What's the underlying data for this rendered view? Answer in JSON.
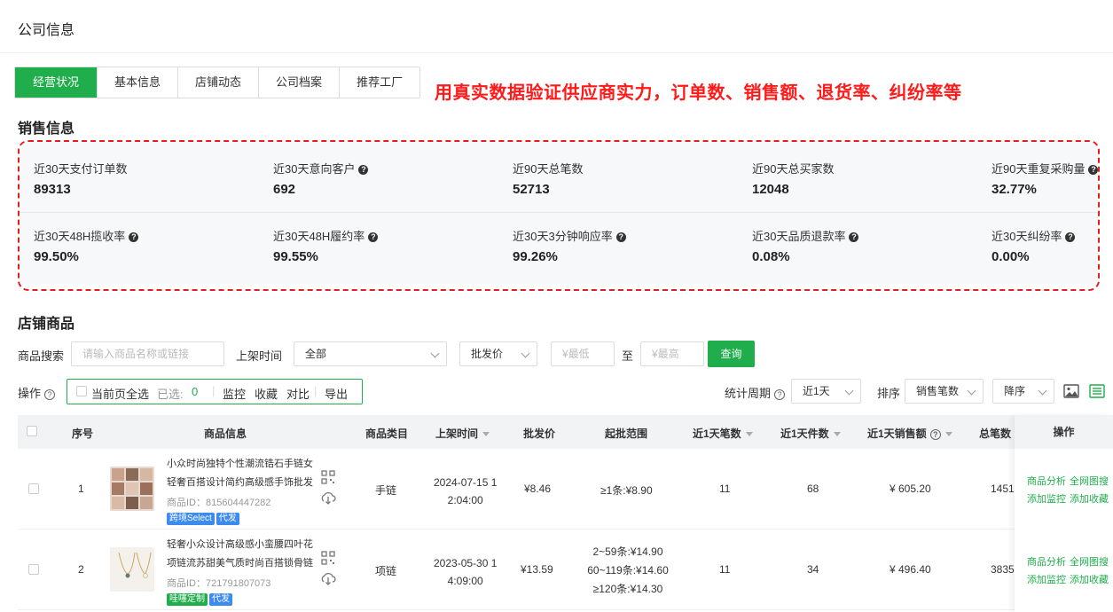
{
  "header": {
    "title": "公司信息"
  },
  "tabs": [
    {
      "label": "经营状况",
      "active": true
    },
    {
      "label": "基本信息",
      "active": false
    },
    {
      "label": "店铺动态",
      "active": false
    },
    {
      "label": "公司档案",
      "active": false
    },
    {
      "label": "推荐工厂",
      "active": false
    }
  ],
  "banner": "用真实数据验证供应商实力，订单数、销售额、退货率、纠纷率等",
  "sales": {
    "title": "销售信息",
    "row1": [
      {
        "label": "近30天支付订单数",
        "value": "89313",
        "help": false
      },
      {
        "label": "近30天意向客户",
        "value": "692",
        "help": true
      },
      {
        "label": "近90天总笔数",
        "value": "52713",
        "help": false
      },
      {
        "label": "近90天总买家数",
        "value": "12048",
        "help": false
      },
      {
        "label": "近90天重复采购量",
        "value": "32.77%",
        "help": true
      }
    ],
    "row2": [
      {
        "label": "近30天48H揽收率",
        "value": "99.50%",
        "help": true
      },
      {
        "label": "近30天48H履约率",
        "value": "99.55%",
        "help": true
      },
      {
        "label": "近30天3分钟响应率",
        "value": "99.26%",
        "help": true
      },
      {
        "label": "近30天品质退款率",
        "value": "0.08%",
        "help": true
      },
      {
        "label": "近30天纠纷率",
        "value": "0.00%",
        "help": true
      }
    ]
  },
  "shop": {
    "title": "店铺商品",
    "search_label": "商品搜索",
    "search_placeholder": "请输入商品名称或链接",
    "date_label": "上架时间",
    "date_value": "全部",
    "price_type": "批发价",
    "min_placeholder": "¥最低",
    "to": "至",
    "max_placeholder": "¥最高",
    "query_button": "查询",
    "ops_label": "操作",
    "select_all": "当前页全选",
    "selected_label": "已选:",
    "selected_count": "0",
    "monitor": "监控",
    "favorite": "收藏",
    "compare": "对比",
    "export": "导出",
    "period_label": "统计周期",
    "period_value": "近1天",
    "sort_label": "排序",
    "sort_value": "销售笔数",
    "order_value": "降序"
  },
  "table": {
    "headers": {
      "index": "序号",
      "info": "商品信息",
      "category": "商品类目",
      "date": "上架时间",
      "price": "批发价",
      "range": "起批范围",
      "orders1d": "近1天笔数",
      "pieces1d": "近1天件数",
      "sales1d": "近1天销售额",
      "total": "总笔数",
      "action": "操作"
    },
    "rows": [
      {
        "index": "1",
        "name1": "小众时尚独特个性潮流锆石手链女",
        "name2": "轻奢百搭设计简约高级感手饰批发",
        "pid": "商品ID：815604447282",
        "tags": [
          "跨境Select",
          "代发"
        ],
        "category": "手链",
        "date1": "2024-07-15 1",
        "date2": "2:04:00",
        "price": "¥8.46",
        "range": [
          "≥1条:¥8.90"
        ],
        "orders": "11",
        "pieces": "68",
        "sales": "¥ 605.20",
        "total": "1451",
        "act1": "商品分析",
        "act2": "全网图搜",
        "act3": "添加监控",
        "act4": "添加收藏"
      },
      {
        "index": "2",
        "name1": "轻奢小众设计高级感小蛮腰四叶花",
        "name2": "项链流苏甜美气质时尚百搭锁骨链",
        "pid": "商品ID：721791807073",
        "tags": [
          "哇噻定制",
          "代发"
        ],
        "category": "项链",
        "date1": "2023-05-30 1",
        "date2": "4:09:00",
        "price": "¥13.59",
        "range": [
          "2~59条:¥14.90",
          "60~119条:¥14.60",
          "≥120条:¥14.30"
        ],
        "orders": "11",
        "pieces": "34",
        "sales": "¥ 496.40",
        "total": "3835",
        "act1": "商品分析",
        "act2": "全网图搜",
        "act3": "添加监控",
        "act4": "添加收藏"
      }
    ]
  },
  "colors": {
    "accent": "#1fae4b",
    "alert": "#ff1a1a",
    "tag_blue": "#3e8bf0"
  }
}
